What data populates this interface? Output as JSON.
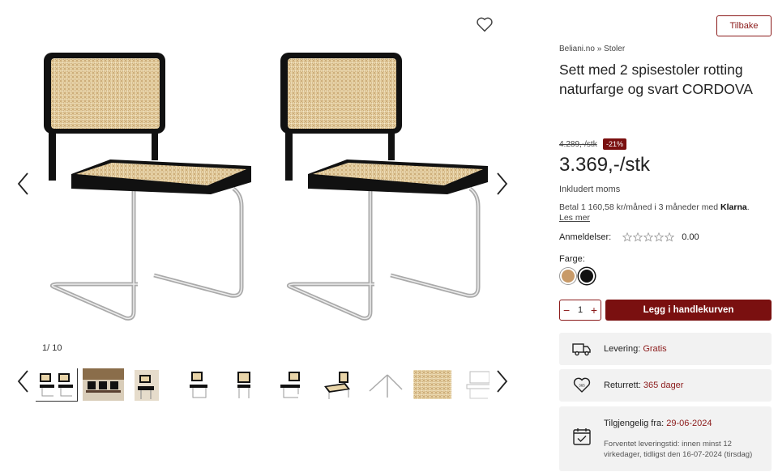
{
  "gallery": {
    "counter_current": "1",
    "counter_sep": "/",
    "counter_total": "10"
  },
  "nav": {
    "back_label": "Tilbake"
  },
  "breadcrumb": {
    "home": "Beliani.no",
    "sep": "»",
    "category": "Stoler"
  },
  "product": {
    "title": "Sett med 2 spisestoler rotting naturfarge og svart CORDOVA",
    "old_price": "4.289,-/stk",
    "discount": "-21%",
    "price": "3.369,-/stk",
    "vat_note": "Inkludert moms",
    "klarna_text": "Betal 1 160,58 kr/måned i 3 måneder med",
    "klarna_brand": "Klarna",
    "klarna_more": "Les mer",
    "reviews_label": "Anmeldelser:",
    "rating_stars": 0,
    "reviews_score": "0.00",
    "color_label": "Farge:",
    "colors": [
      "#c89a68",
      "#111111"
    ],
    "quantity": "1",
    "cart_label": "Legg i handlekurven"
  },
  "info": {
    "delivery_label": "Levering:",
    "delivery_value": "Gratis",
    "return_label": "Returrett:",
    "return_value": "365 dager",
    "available_label": "Tilgjengelig fra:",
    "available_value": "29-06-2024",
    "expected_text": "Forventet leveringstid: innen minst 12 virkedager, tidligst den 16-07-2024 (tirsdag)"
  },
  "colors": {
    "accent": "#7a1010",
    "accent_text": "#8b1a1a"
  }
}
